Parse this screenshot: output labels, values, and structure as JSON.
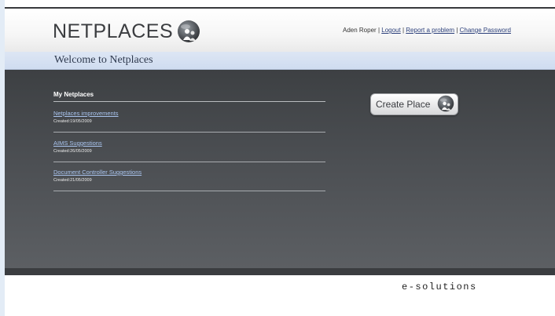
{
  "header": {
    "logo_text": "NETPLACES",
    "user_name": "Aden Roper",
    "links": {
      "logout": "Logout",
      "report": "Report a problem",
      "change_password": "Change Password"
    },
    "separator": "|"
  },
  "welcome": {
    "title": "Welcome to Netplaces"
  },
  "my_netplaces": {
    "title": "My Netplaces",
    "places": [
      {
        "name": "Netplaces improvements",
        "created": "Created:19/05/2009"
      },
      {
        "name": "AIMS Suggestions",
        "created": "Created:26/05/2009"
      },
      {
        "name": "Document Controller Suggestions",
        "created": "Created:21/05/2009"
      }
    ]
  },
  "actions": {
    "create_place": "Create Place"
  },
  "footer": {
    "brand": "e-solutions"
  },
  "colors": {
    "header_bg": "#f4f4f4",
    "welcome_bar": "#d6e1f2",
    "main_bg": "#4a4d51",
    "link": "#2b3f7a",
    "place_link": "#a9c4ee"
  },
  "icons": {
    "logo_globe": "globe-people-icon",
    "create_globe": "globe-people-icon"
  }
}
